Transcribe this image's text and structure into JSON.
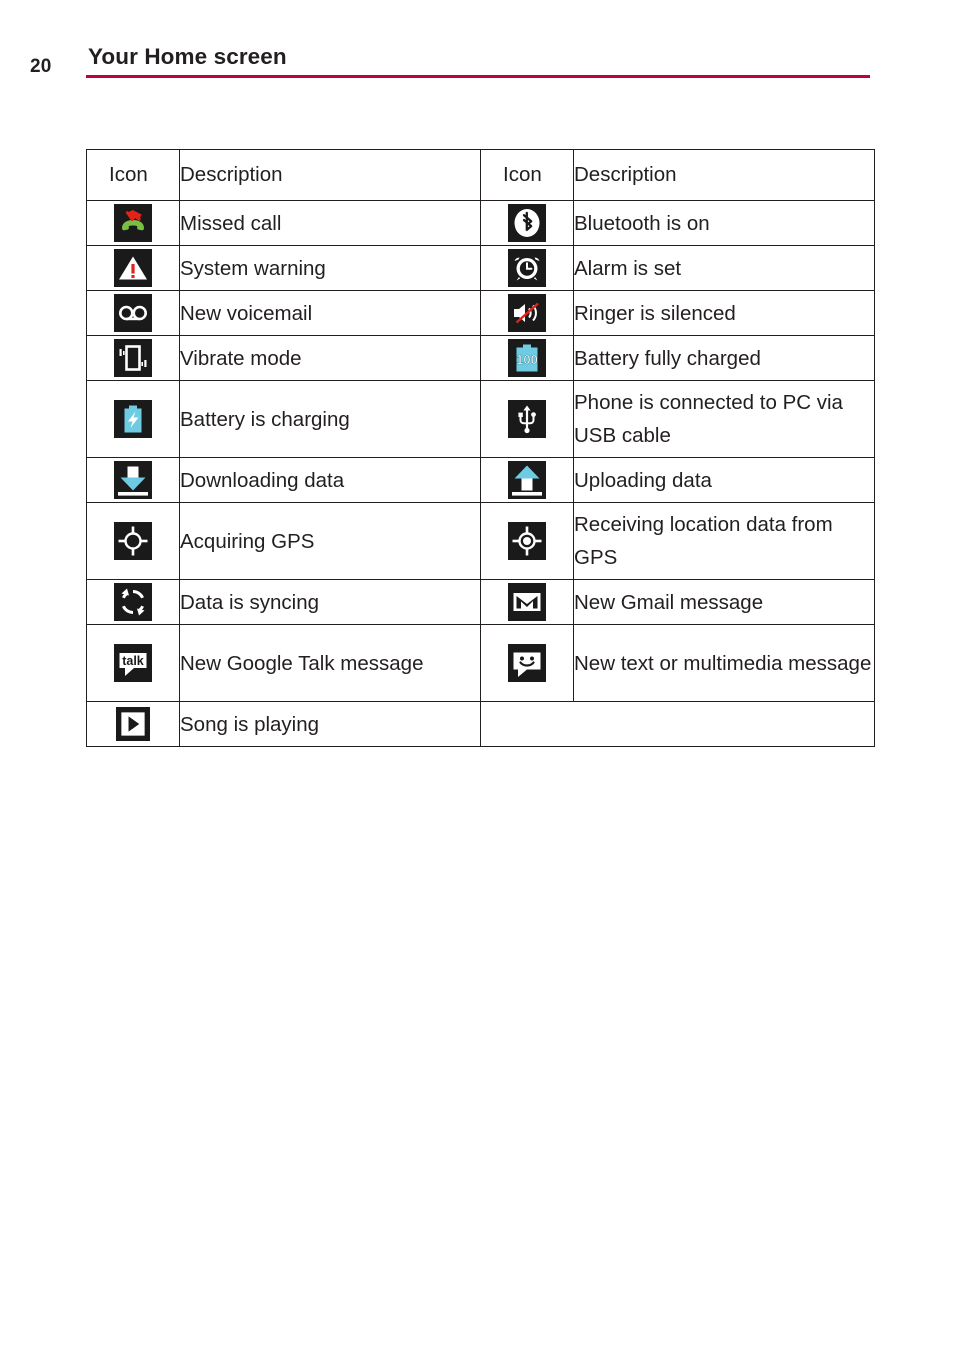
{
  "header": {
    "page_number": "20",
    "title": "Your Home screen",
    "rule_color": "#c2003c"
  },
  "table": {
    "columns": [
      "Icon",
      "Description",
      "Icon",
      "Description"
    ],
    "rows": [
      {
        "left": {
          "icon": "missed-call-icon",
          "description": "Missed call"
        },
        "right": {
          "icon": "bluetooth-icon",
          "description": "Bluetooth is on"
        }
      },
      {
        "left": {
          "icon": "system-warning-icon",
          "description": "System warning"
        },
        "right": {
          "icon": "alarm-clock-icon",
          "description": "Alarm is set"
        }
      },
      {
        "left": {
          "icon": "voicemail-icon",
          "description": "New voicemail"
        },
        "right": {
          "icon": "ringer-silenced-icon",
          "description": "Ringer is silenced"
        }
      },
      {
        "left": {
          "icon": "vibrate-mode-icon",
          "description": "Vibrate mode"
        },
        "right": {
          "icon": "battery-full-icon",
          "description": "Battery fully charged"
        }
      },
      {
        "left": {
          "icon": "battery-charging-icon",
          "description": "Battery is charging"
        },
        "right": {
          "icon": "usb-icon",
          "description": "Phone is connected to PC via USB cable"
        }
      },
      {
        "left": {
          "icon": "download-icon",
          "description": "Downloading data"
        },
        "right": {
          "icon": "upload-icon",
          "description": "Uploading data"
        }
      },
      {
        "left": {
          "icon": "gps-acquiring-icon",
          "description": "Acquiring GPS"
        },
        "right": {
          "icon": "gps-locked-icon",
          "description": "Receiving location data from GPS"
        }
      },
      {
        "left": {
          "icon": "sync-icon",
          "description": "Data is syncing"
        },
        "right": {
          "icon": "gmail-icon",
          "description": "New Gmail message"
        }
      },
      {
        "left": {
          "icon": "google-talk-icon",
          "description": "New Google Talk message"
        },
        "right": {
          "icon": "sms-icon",
          "description": "New text or multimedia message"
        }
      },
      {
        "left": {
          "icon": "play-icon",
          "description": "Song is playing"
        },
        "right": {
          "icon": "",
          "description": ""
        }
      }
    ]
  },
  "colors": {
    "accent_rule": "#c2003c",
    "icon_background": "#1a1a1a",
    "battery_cyan": "#6ecbe2",
    "phone_green": "#77c043",
    "arrow_red": "#e22319",
    "text": "#231f20"
  }
}
